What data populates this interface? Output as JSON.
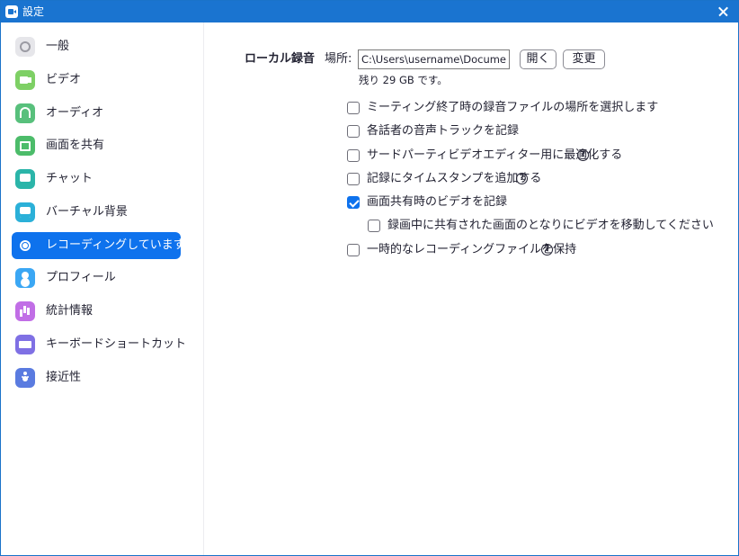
{
  "window": {
    "title": "設定",
    "close_icon": "close-icon"
  },
  "sidebar": {
    "items": [
      {
        "label": "一般",
        "icon": "gear-icon",
        "active": false
      },
      {
        "label": "ビデオ",
        "icon": "video-camera-icon",
        "active": false
      },
      {
        "label": "オーディオ",
        "icon": "headphones-icon",
        "active": false
      },
      {
        "label": "画面を共有",
        "icon": "share-screen-icon",
        "active": false
      },
      {
        "label": "チャット",
        "icon": "chat-bubble-icon",
        "active": false
      },
      {
        "label": "バーチャル背景",
        "icon": "virtual-background-icon",
        "active": false
      },
      {
        "label": "レコーディングしています",
        "icon": "record-icon",
        "active": true
      },
      {
        "label": "プロフィール",
        "icon": "profile-icon",
        "active": false
      },
      {
        "label": "統計情報",
        "icon": "statistics-icon",
        "active": false
      },
      {
        "label": "キーボードショートカット",
        "icon": "keyboard-icon",
        "active": false
      },
      {
        "label": "接近性",
        "icon": "accessibility-icon",
        "active": false
      }
    ]
  },
  "recording": {
    "section_label": "ローカル録音",
    "location_label": "場所:",
    "path_value": "C:\\Users\\username\\Documents\\Zoom",
    "open_button": "開く",
    "change_button": "変更",
    "free_space": "残り 29 GB です。",
    "options": [
      {
        "label": "ミーティング終了時の録音ファイルの場所を選択します",
        "checked": false,
        "help": false
      },
      {
        "label": "各話者の音声トラックを記録",
        "checked": false,
        "help": false
      },
      {
        "label": "サードパーティビデオエディター用に最適化する",
        "checked": false,
        "help": true
      },
      {
        "label": "記録にタイムスタンプを追加する",
        "checked": false,
        "help": true
      },
      {
        "label": "画面共有時のビデオを記録",
        "checked": true,
        "help": false
      },
      {
        "label": "録画中に共有された画面のとなりにビデオを移動してください",
        "checked": false,
        "help": false
      },
      {
        "label": "一時的なレコーディングファイルを保持",
        "checked": false,
        "help": true
      }
    ],
    "help_glyph": "?"
  },
  "colors": {
    "titlebar": "#1a74d0",
    "accent": "#0e72ed"
  }
}
